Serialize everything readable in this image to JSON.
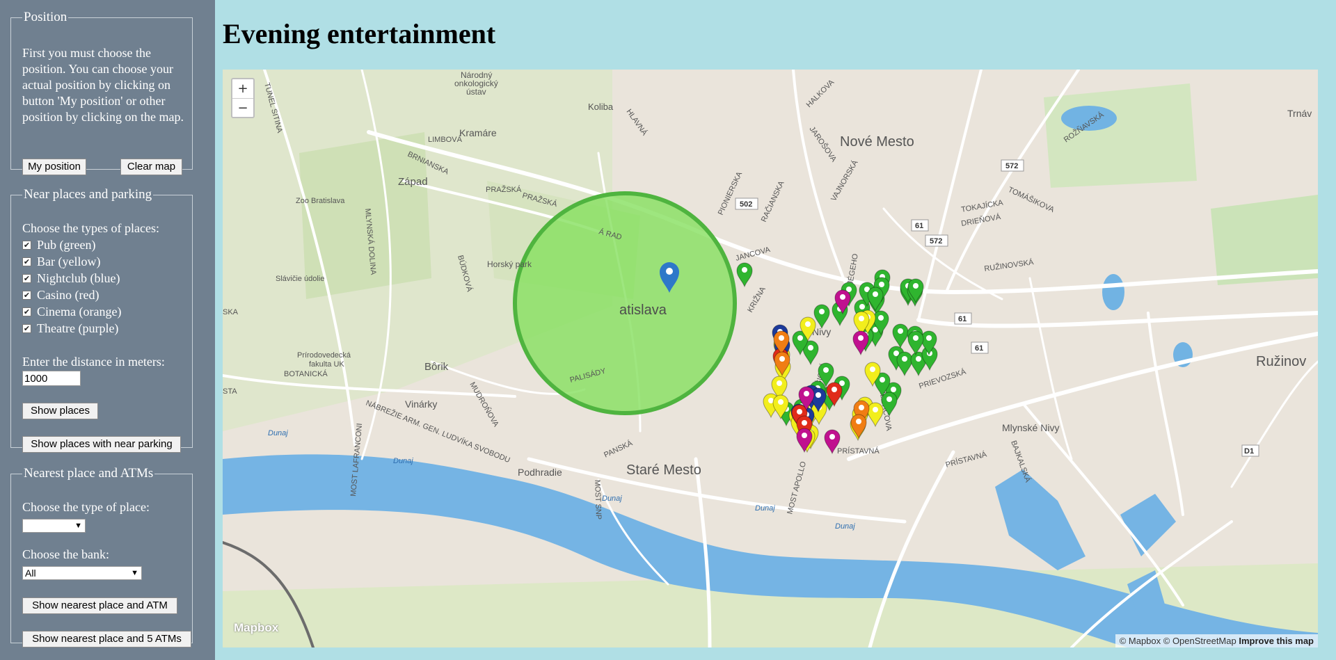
{
  "page": {
    "title": "Evening entertainment"
  },
  "position_panel": {
    "legend": "Position",
    "description": "First you must choose the position. You can choose your actual position by clicking on button 'My position' or other position by clicking on the map.",
    "my_position_button": "My position",
    "clear_map_button": "Clear map"
  },
  "near_panel": {
    "legend": "Near places and parking",
    "types_label": "Choose the types of places:",
    "types": [
      {
        "label": "Pub (green)",
        "checked": true
      },
      {
        "label": "Bar (yellow)",
        "checked": true
      },
      {
        "label": "Nightclub (blue)",
        "checked": true
      },
      {
        "label": "Casino (red)",
        "checked": true
      },
      {
        "label": "Cinema (orange)",
        "checked": true
      },
      {
        "label": "Theatre (purple)",
        "checked": true
      }
    ],
    "distance_label": "Enter the distance in meters:",
    "distance_value": "1000",
    "show_places_button": "Show places",
    "show_parking_button": "Show places with near parking"
  },
  "nearest_panel": {
    "legend": "Nearest place and ATMs",
    "type_label": "Choose the type of place:",
    "type_value": "",
    "bank_label": "Choose the bank:",
    "bank_value": "All",
    "nearest_atm_button": "Show nearest place and ATM",
    "nearest_5_atms_button": "Show nearest place and 5 ATMs"
  },
  "map": {
    "zoom_in": "+",
    "zoom_out": "−",
    "logo": "Mapbox",
    "attribution": "© Mapbox © OpenStreetMap",
    "improve": "Improve this map",
    "labels": {
      "narodny": "Národný",
      "onkologicky": "onkologický",
      "ustav": "ústav",
      "koliba": "Koliba",
      "nove_mesto": "Nové Mesto",
      "trnav": "Trnáv",
      "zapad": "Západ",
      "zoo": "Zoo Bratislava",
      "horsky": "Horský park",
      "slavicie": "Slávičie údolie",
      "prirodo1": "Prírodovedecká",
      "prirodo2": "fakulta UK",
      "borik": "Bôrik",
      "vinarky": "Vinárky",
      "podhradie": "Podhradie",
      "stare_mesto": "Staré Mesto",
      "bratislava": "atislava",
      "nivy": "Nivy",
      "ruzinov": "Ružinov",
      "mlynske": "Mlynské Nivy",
      "dunaj": "Dunaj",
      "kramare": "Kramáre",
      "limbova": "LIMBOVÁ",
      "brnianska": "BRNIANSKA",
      "prazska": "PRAŽSKÁ",
      "mlynska": "MLYNSKÁ DOLINA",
      "tunel": "TUNEL SITINA",
      "botanicka": "BOTANICKÁ",
      "prievozska": "PRIEVOZSKÁ",
      "pristavna": "PRÍSTAVNÁ",
      "most_snp": "MOST SNP",
      "most_apollo": "MOST APOLLO",
      "most_lafranconi": "MOST LAFRANCONI",
      "nabrezie": "NÁBREŽIE ARM. GEN. LUDVÍKA SVOBODU",
      "r502": "502",
      "r572": "572",
      "r61": "61",
      "d1": "D1",
      "halkova": "HALKOVA",
      "jarosova": "JAROŠOVA",
      "vajnorska": "VAJNORSKÁ",
      "racianska": "RAČIANSKA",
      "tomasikova": "TOMÁŠIKOVA",
      "ruzinovska": "RUŽINOVSKÁ",
      "mudronova": "MUDROŇOVA",
      "budkova": "BÚDKOVÁ",
      "kosicka": "KOŠICKÁ",
      "miletic": "MILETIČOVA",
      "bajkalska": "BAJKALSKÁ",
      "jegeho": "JÉGEHO",
      "hlavna": "HLAVNÁ",
      "panska": "PANSKÁ",
      "sta": "STA",
      "ska": "SKA",
      "palisady": "PALISÁDY",
      "kriz": "KRIŽNA",
      "rad": "Á RAD",
      "pionierska": "PIONIERSKA",
      "rozn": "ROŽŇAVSKÁ",
      "drienova": "DRIEŇOVÁ",
      "tokajicka": "TOKAJÍCKA",
      "jancova": "JANCOVA"
    },
    "colors": {
      "pub": "#2fb52f",
      "bar": "#f2ee1d",
      "nightclub": "#1d3a9a",
      "casino": "#e02b1a",
      "cinema": "#f07d14",
      "theatre": "#c0118f",
      "position": "#2e78c9",
      "circle": "#7ed957"
    }
  }
}
